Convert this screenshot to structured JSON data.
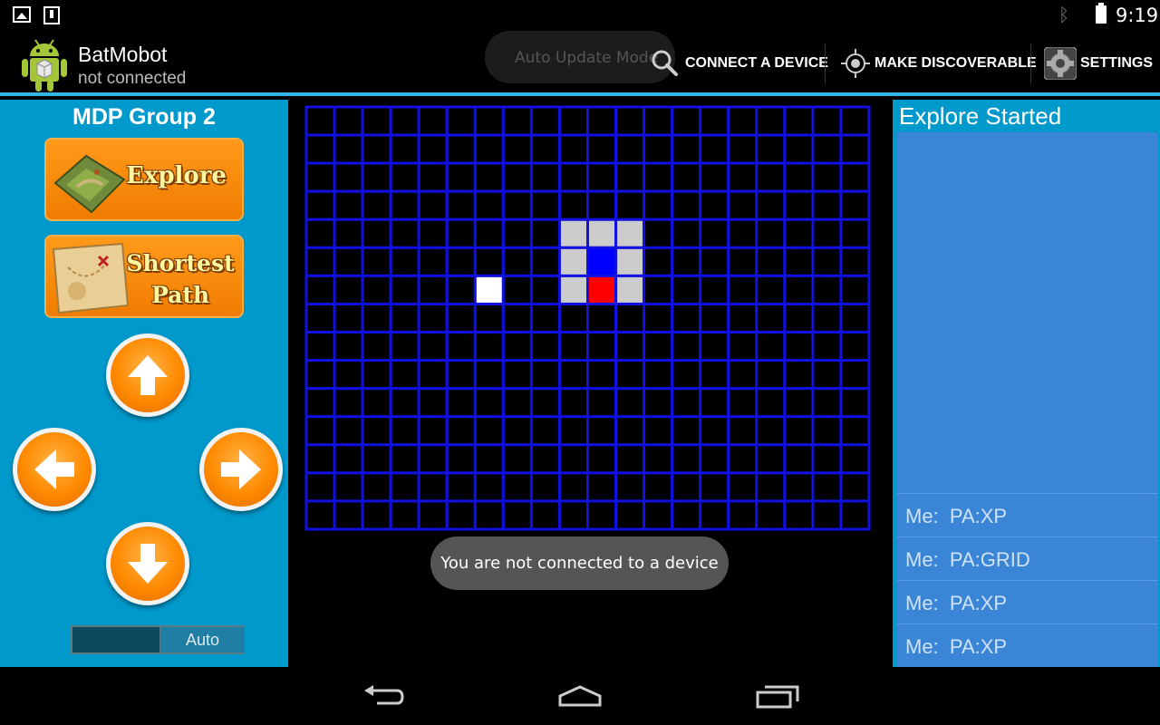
{
  "status_bar": {
    "time": "9:19",
    "icons": [
      "gallery-icon",
      "download-icon",
      "bluetooth-icon",
      "battery-icon"
    ]
  },
  "action_bar": {
    "title": "BatMobot",
    "subtitle": "not connected",
    "auto_update_placeholder": "Auto Update Mode",
    "actions": {
      "connect": "CONNECT A DEVICE",
      "discoverable": "MAKE DISCOVERABLE",
      "settings": "SETTINGS"
    },
    "accent_color": "#33b5e5"
  },
  "left_panel": {
    "title": "MDP Group 2",
    "explore_label": "Explore",
    "shortest_path_label_line1": "Shortest",
    "shortest_path_label_line2": "Path",
    "toggle_label": "Auto",
    "panel_color": "#0099cc"
  },
  "arena": {
    "columns": 20,
    "rows": 15,
    "grid_line_color": "#1010e0",
    "cells": [
      {
        "row": 4,
        "col": 9,
        "type": "robot-body",
        "color": "#cccccc"
      },
      {
        "row": 4,
        "col": 10,
        "type": "robot-body",
        "color": "#cccccc"
      },
      {
        "row": 4,
        "col": 11,
        "type": "robot-body",
        "color": "#cccccc"
      },
      {
        "row": 5,
        "col": 9,
        "type": "robot-body",
        "color": "#cccccc"
      },
      {
        "row": 5,
        "col": 10,
        "type": "robot-center",
        "color": "#0000ff"
      },
      {
        "row": 5,
        "col": 11,
        "type": "robot-body",
        "color": "#cccccc"
      },
      {
        "row": 6,
        "col": 9,
        "type": "robot-body",
        "color": "#cccccc"
      },
      {
        "row": 6,
        "col": 10,
        "type": "robot-head",
        "color": "#ff0000"
      },
      {
        "row": 6,
        "col": 11,
        "type": "robot-body",
        "color": "#cccccc"
      },
      {
        "row": 6,
        "col": 6,
        "type": "waypoint",
        "color": "#ffffff"
      }
    ]
  },
  "toast": "You are not connected to a device",
  "right_panel": {
    "status": "Explore Started",
    "log": [
      "Me:  PA:XP",
      "Me:  PA:GRID",
      "Me:  PA:XP",
      "Me:  PA:XP"
    ]
  },
  "nav_bar": {
    "buttons": [
      "back-icon",
      "home-icon",
      "recent-apps-icon"
    ]
  }
}
